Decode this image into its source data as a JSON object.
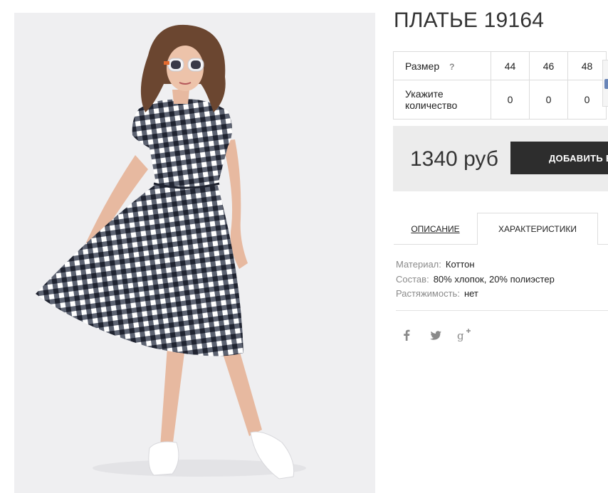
{
  "product": {
    "title": "ПЛАТЬЕ 19164",
    "image_alt": "woman in black and white gingham dress with white sneakers"
  },
  "sizes": {
    "size_label": "Размер",
    "help": "?",
    "qty_label": "Укажите количество",
    "values": [
      "44",
      "46",
      "48"
    ],
    "quantities": [
      "0",
      "0",
      "0"
    ]
  },
  "purchase": {
    "price": "1340 руб",
    "add_button": "ДОБАВИТЬ В КОРЗИНУ",
    "bag_icon": "shopping-bag-icon",
    "colors": {
      "button_bg": "#2d2d2d",
      "panel_bg": "#ececec"
    }
  },
  "tabs": {
    "description": "ОПИСАНИЕ",
    "characteristics": "ХАРАКТЕРИСТИКИ",
    "active": "characteristics"
  },
  "specs": [
    {
      "key": "Материал:",
      "value": "Коттон"
    },
    {
      "key": "Состав:",
      "value": "80% хлопок, 20% полиэстер"
    },
    {
      "key": "Растяжимость:",
      "value": "нет"
    }
  ],
  "social": {
    "icons": [
      "facebook-icon",
      "twitter-icon",
      "google-plus-icon"
    ]
  }
}
